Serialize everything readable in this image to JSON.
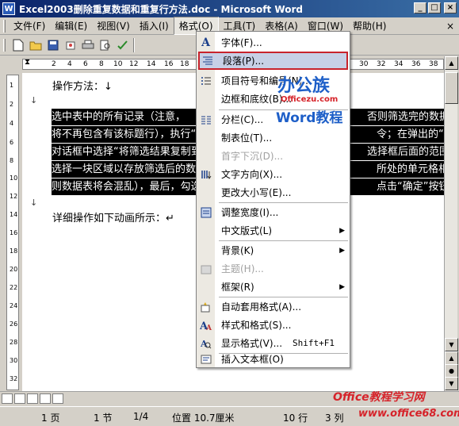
{
  "window": {
    "title": "Excel2003删除重复数据和重复行方法.doc - Microsoft Word",
    "icon_label": "W",
    "buttons": [
      "_",
      "□",
      "×"
    ]
  },
  "menubar": {
    "items": [
      "文件(F)",
      "编辑(E)",
      "视图(V)",
      "插入(I)",
      "格式(O)",
      "工具(T)",
      "表格(A)",
      "窗口(W)",
      "帮助(H)"
    ],
    "close_x": "×"
  },
  "toolbar": {
    "buttons": [
      "new-icon",
      "open-icon",
      "save-icon",
      "permission-icon",
      "print-icon",
      "print-preview-icon",
      "spelling-icon"
    ],
    "right_icons": [
      "A",
      "A"
    ]
  },
  "ruler": {
    "ticks": [
      "2",
      "4",
      "6",
      "8",
      "10",
      "12",
      "14",
      "16",
      "18",
      "30",
      "32",
      "34",
      "36",
      "38"
    ]
  },
  "vruler": {
    "ticks": [
      "1",
      "2",
      "4",
      "6",
      "8",
      "10",
      "12",
      "14",
      "16",
      "18",
      "20",
      "22",
      "24",
      "26",
      "28",
      "30",
      "32"
    ]
  },
  "document": {
    "heading1": "操作方法：↓",
    "blank_mark": "↓",
    "selected_lines": [
      "选中表中的所有记录（注意，",
      "将不再包含有该标题行），执行“数",
      "对话框中选择“将筛选结果复制到其",
      "选择一块区域以存放筛选后的数据（",
      "则数据表将会混乱），最后，勾选“"
    ],
    "selected_right": [
      "否则筛选完的数据",
      "令；在弹出的“高级",
      "选择框后面的范围拟",
      "所处的单元格相重",
      "点击“确定”按钮即可"
    ],
    "heading2": "详细操作如下动画所示：↵"
  },
  "format_menu": {
    "items": [
      {
        "label": "字体(F)...",
        "icon": "A"
      },
      {
        "label": "段落(P)...",
        "icon": "paragraph-icon"
      },
      {
        "label": "项目符号和编号(N)...",
        "icon": "bullets-icon"
      },
      {
        "label": "边框和底纹(B)...",
        "icon": ""
      },
      {
        "label": "分栏(C)...",
        "icon": "columns-icon"
      },
      {
        "label": "制表位(T)...",
        "icon": ""
      },
      {
        "label": "首字下沉(D)...",
        "icon": ""
      },
      {
        "label": "文字方向(X)...",
        "icon": "text-direction-icon"
      },
      {
        "label": "更改大小写(E)...",
        "icon": ""
      },
      {
        "label": "调整宽度(I)...",
        "icon": "fit-width-icon"
      },
      {
        "label": "中文版式(L)",
        "icon": ""
      },
      {
        "label": "背景(K)",
        "icon": ""
      },
      {
        "label": "主题(H)...",
        "icon": "theme-icon"
      },
      {
        "label": "框架(R)",
        "icon": ""
      },
      {
        "label": "自动套用格式(A)...",
        "icon": "autoformat-icon"
      },
      {
        "label": "样式和格式(S)...",
        "icon": "styles-icon"
      },
      {
        "label": "显示格式(V)...",
        "icon": "reveal-formatting-icon"
      },
      {
        "label": "插入文本框(O)",
        "icon": "textbox-icon"
      }
    ],
    "shortcut_reveal": "Shift+F1",
    "submenu_arrow": "▶"
  },
  "logo": {
    "main": "办公族",
    "url": "Officezu.com",
    "word": "Word教程"
  },
  "statusbar": {
    "page": "1 页",
    "section": "1 节",
    "page_of": "1/4",
    "position": "位置 10.7厘米",
    "line": "10 行",
    "col": "3 列"
  },
  "watermark": {
    "line1": "Office教程学习网",
    "line2": "www.office68.com"
  }
}
